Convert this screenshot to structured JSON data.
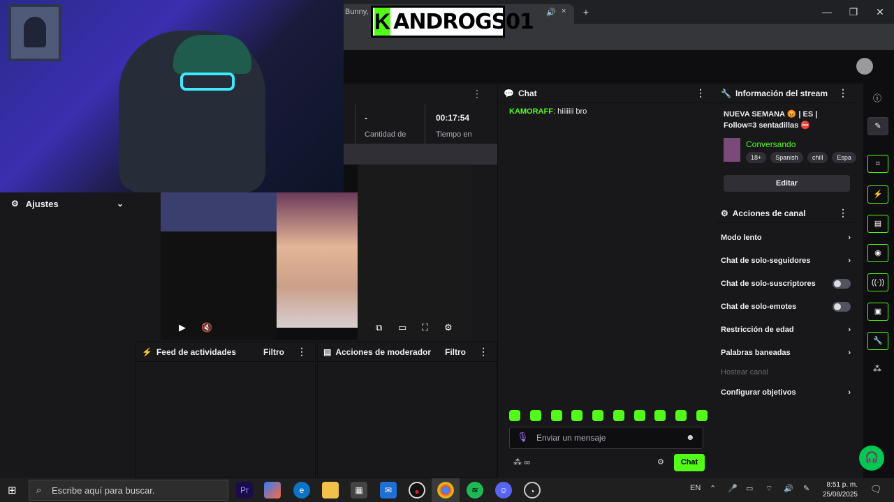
{
  "browser": {
    "tab_title": "Bunny, O... Your Day",
    "tab_close": "×",
    "new_tab": "+",
    "win_min": "—",
    "win_max": "❐",
    "win_close": "✕"
  },
  "overlay": {
    "logo_letter": "K",
    "channel_name": "ANDROGS01"
  },
  "left_panel": {
    "title": "Ajustes"
  },
  "stats": {
    "value_left": "-",
    "label_left": "Cantidad de",
    "value_right": "00:17:54",
    "label_right": "Tiempo en"
  },
  "feed": {
    "title": "Feed de actividades",
    "filter": "Filtro"
  },
  "moderator": {
    "title": "Acciones de moderador",
    "filter": "Filtro"
  },
  "chat": {
    "title": "Chat",
    "messages": [
      {
        "user": "KAMORAFF",
        "text": "hiiiiiii bro"
      }
    ],
    "input_placeholder": "Enviar un mensaje",
    "send_label": "Chat"
  },
  "stream_info": {
    "title": "Información del stream",
    "stream_title": "NUEVA SEMANA 😡 | ES | Follow=3 sentadillas ⛔",
    "category": "Conversando",
    "tags": [
      "18+",
      "Spanish",
      "chill",
      "Espa"
    ],
    "edit_label": "Editar"
  },
  "channel_actions": {
    "title": "Acciones de canal",
    "items": [
      {
        "label": "Modo lento",
        "control": "chevron"
      },
      {
        "label": "Chat de solo-seguidores",
        "control": "chevron"
      },
      {
        "label": "Chat de solo-suscriptores",
        "control": "toggle"
      },
      {
        "label": "Chat de solo-emotes",
        "control": "toggle"
      },
      {
        "label": "Restricción de edad",
        "control": "chevron"
      },
      {
        "label": "Palabras baneadas",
        "control": "chevron"
      },
      {
        "label": "Hostear canal",
        "control": "disabled"
      },
      {
        "label": "Configurar objetivos",
        "control": "chevron"
      }
    ]
  },
  "taskbar": {
    "search_placeholder": "Escribe aquí para buscar.",
    "lang": "EN",
    "time": "8:51 p. m.",
    "date": "25/08/2025"
  },
  "colors": {
    "accent": "#53fc18",
    "background": "#18181b",
    "panel_border": "#0e0e10"
  }
}
